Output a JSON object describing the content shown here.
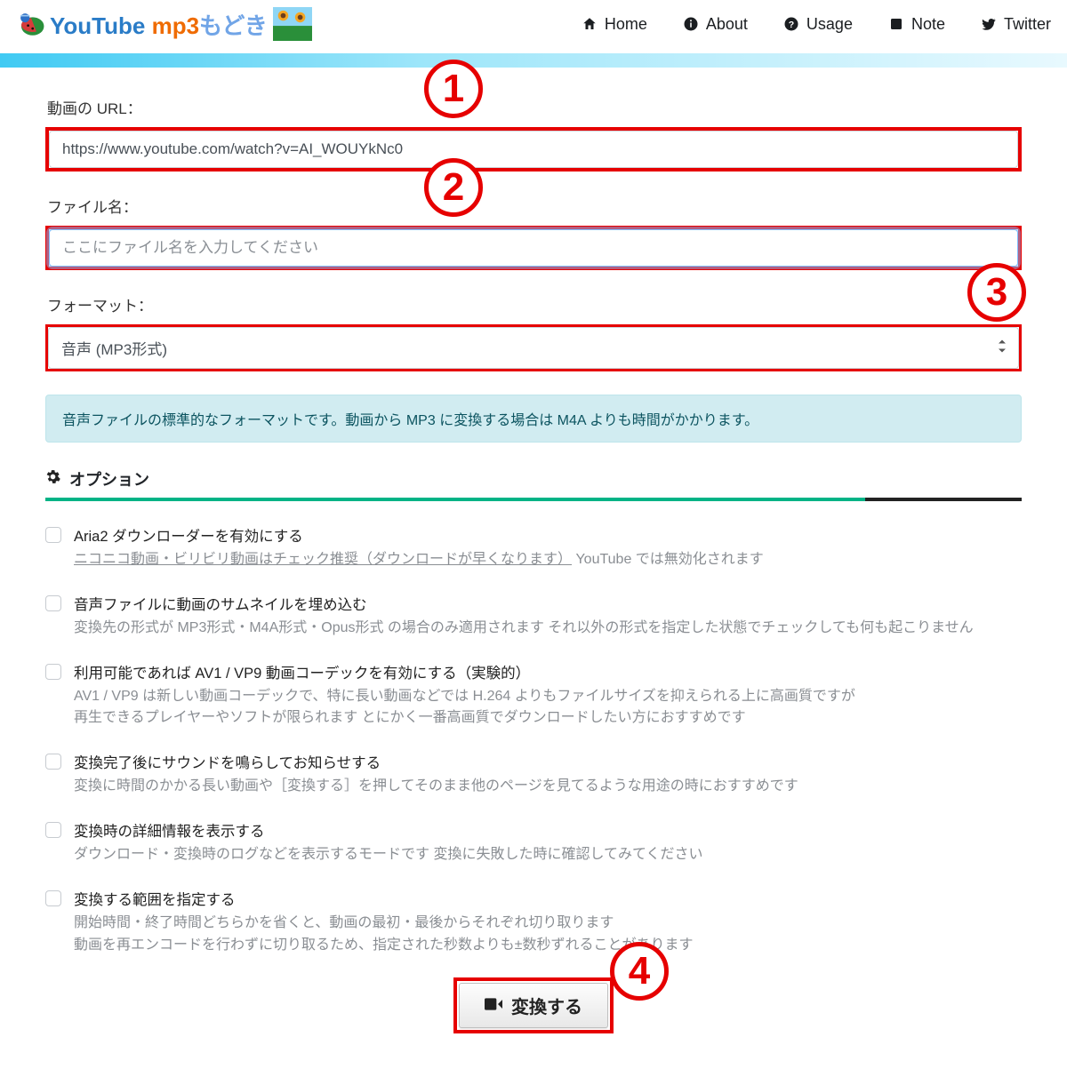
{
  "brand": {
    "yt": "YouTube",
    "mp3": " mp3",
    "modoki": "もどき"
  },
  "nav": {
    "home": "Home",
    "about": "About",
    "usage": "Usage",
    "note": "Note",
    "twitter": "Twitter"
  },
  "form": {
    "url_label": "動画の URL：",
    "url_value": "https://www.youtube.com/watch?v=AI_WOUYkNc0",
    "file_label": "ファイル名：",
    "file_placeholder": "ここにファイル名を入力してください",
    "format_label": "フォーマット：",
    "format_value": "音声 (MP3形式)",
    "info": "音声ファイルの標準的なフォーマットです。動画から MP3 に変換する場合は M4A よりも時間がかかります。",
    "options_heading": "オプション",
    "submit": "変換する"
  },
  "badges": {
    "n1": "1",
    "n2": "2",
    "n3": "3",
    "n4": "4"
  },
  "options": [
    {
      "title": "Aria2 ダウンローダーを有効にする",
      "desc_underline": "ニコニコ動画・ビリビリ動画はチェック推奨（ダウンロードが早くなります）",
      "desc_tail": " YouTube では無効化されます"
    },
    {
      "title": "音声ファイルに動画のサムネイルを埋め込む",
      "desc": "変換先の形式が MP3形式・M4A形式・Opus形式 の場合のみ適用されます それ以外の形式を指定した状態でチェックしても何も起こりません"
    },
    {
      "title": "利用可能であれば AV1 / VP9 動画コーデックを有効にする（実験的）",
      "desc_line1": "AV1 / VP9 は新しい動画コーデックで、特に長い動画などでは H.264 よりもファイルサイズを抑えられる上に高画質ですが",
      "desc_line2": "再生できるプレイヤーやソフトが限られます とにかく一番高画質でダウンロードしたい方におすすめです"
    },
    {
      "title": "変換完了後にサウンドを鳴らしてお知らせする",
      "desc": "変換に時間のかかる長い動画や［変換する］を押してそのまま他のページを見てるような用途の時におすすめです"
    },
    {
      "title": "変換時の詳細情報を表示する",
      "desc": "ダウンロード・変換時のログなどを表示するモードです 変換に失敗した時に確認してみてください"
    },
    {
      "title": "変換する範囲を指定する",
      "desc_line1": "開始時間・終了時間どちらかを省くと、動画の最初・最後からそれぞれ切り取ります",
      "desc_line2": "動画を再エンコードを行わずに切り取るため、指定された秒数よりも±数秒ずれることがあります"
    }
  ]
}
